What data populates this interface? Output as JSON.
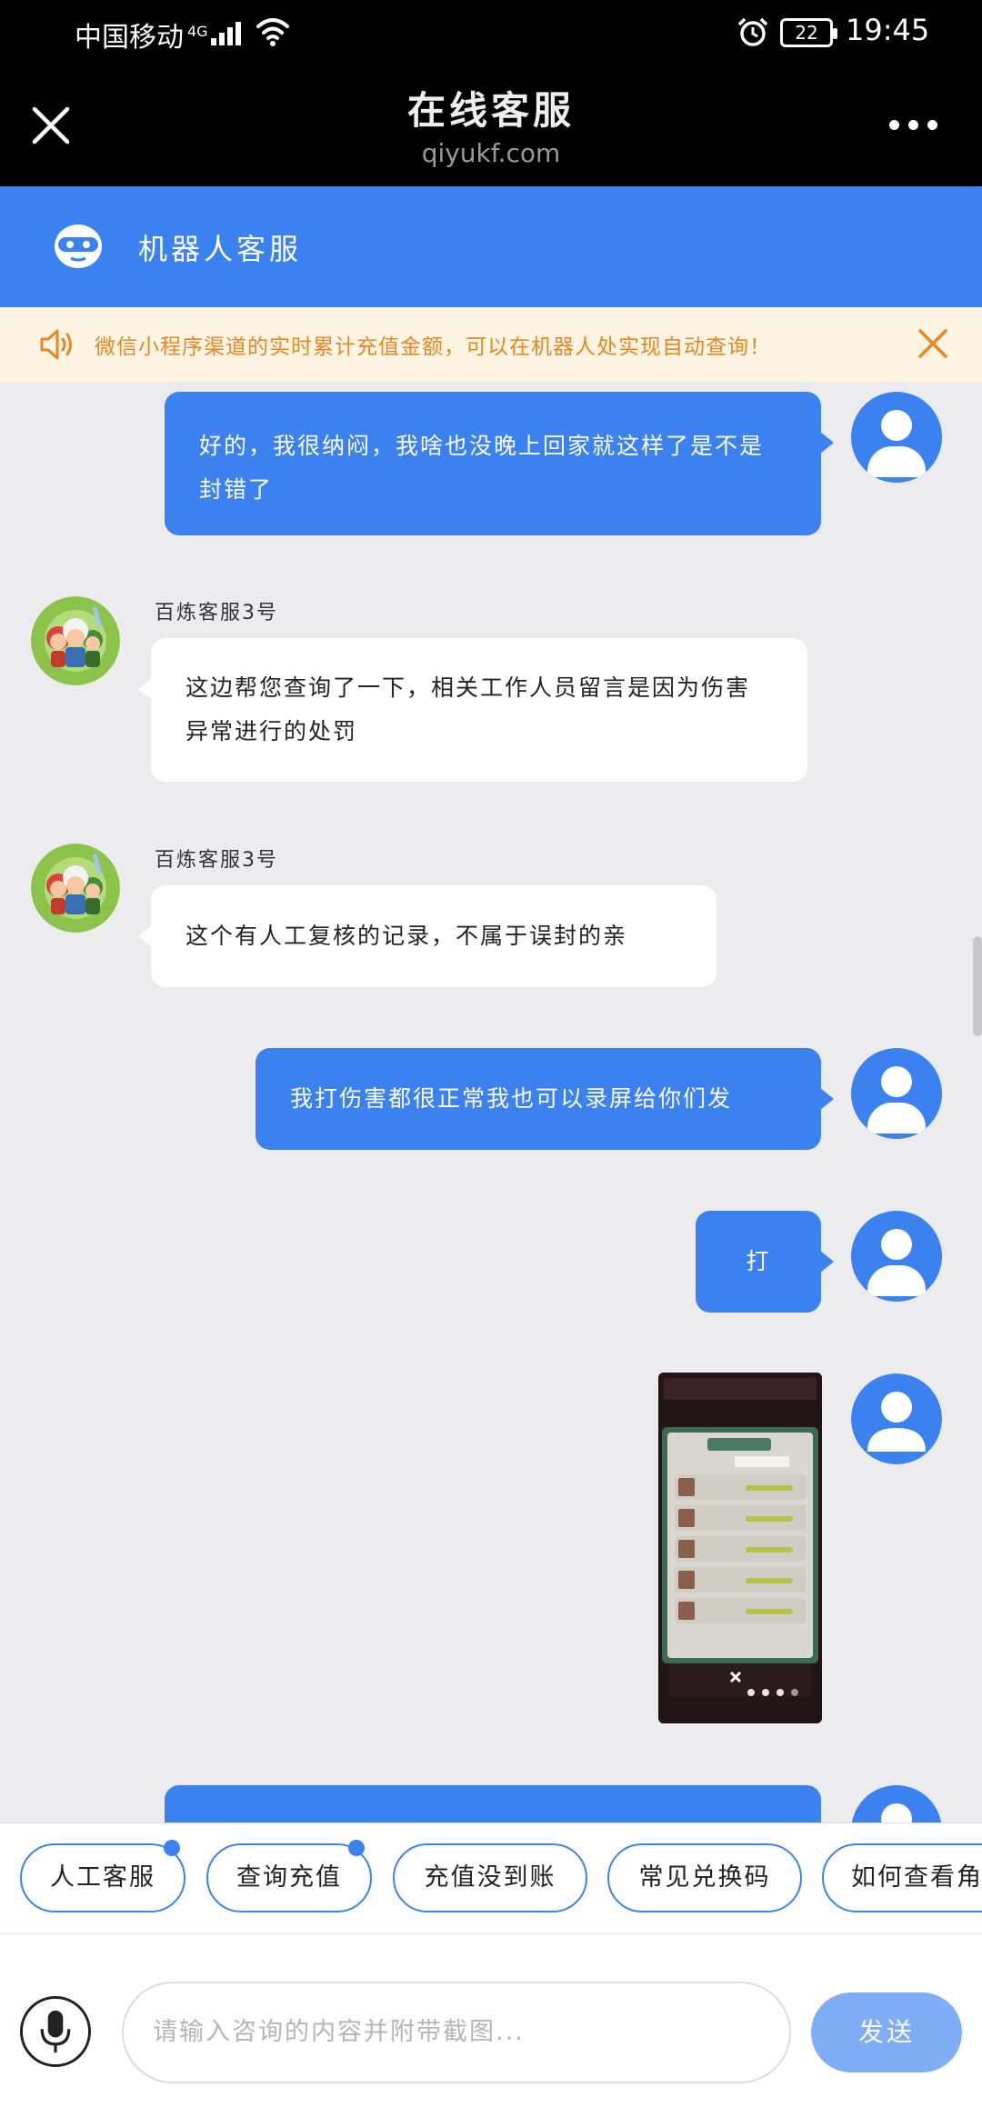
{
  "status_bar": {
    "carrier": "中国移动",
    "network": "4G",
    "battery": "22",
    "time": "19:45"
  },
  "header": {
    "title": "在线客服",
    "subtitle": "qiyukf.com"
  },
  "robot_bar": {
    "title": "机器人客服"
  },
  "notice": {
    "text": "微信小程序渠道的实时累计充值金额，可以在机器人处实现自动查询！"
  },
  "messages": [
    {
      "from": "user",
      "text": "好的，我很纳闷，我啥也没晚上回家就这样了是不是封错了"
    },
    {
      "from": "agent",
      "name": "百炼客服3号",
      "text": "这边帮您查询了一下，相关工作人员留言是因为伤害异常进行的处罚"
    },
    {
      "from": "agent",
      "name": "百炼客服3号",
      "text": "这个有人工复核的记录，不属于误封的亲"
    },
    {
      "from": "user",
      "text": "我打伤害都很正常我也可以录屏给你们发"
    },
    {
      "from": "user",
      "text": "打"
    },
    {
      "from": "user",
      "type": "image"
    }
  ],
  "quick_replies": [
    "人工客服",
    "查询充值",
    "充值没到账",
    "常见兑换码",
    "如何查看角"
  ],
  "input": {
    "placeholder": "请输入咨询的内容并附带截图...",
    "send_label": "发送"
  },
  "colors": {
    "accent": "#3b82f0",
    "notice_text": "#e8861f",
    "notice_bg": "#fdf4e4",
    "chat_bg": "#ececef"
  }
}
